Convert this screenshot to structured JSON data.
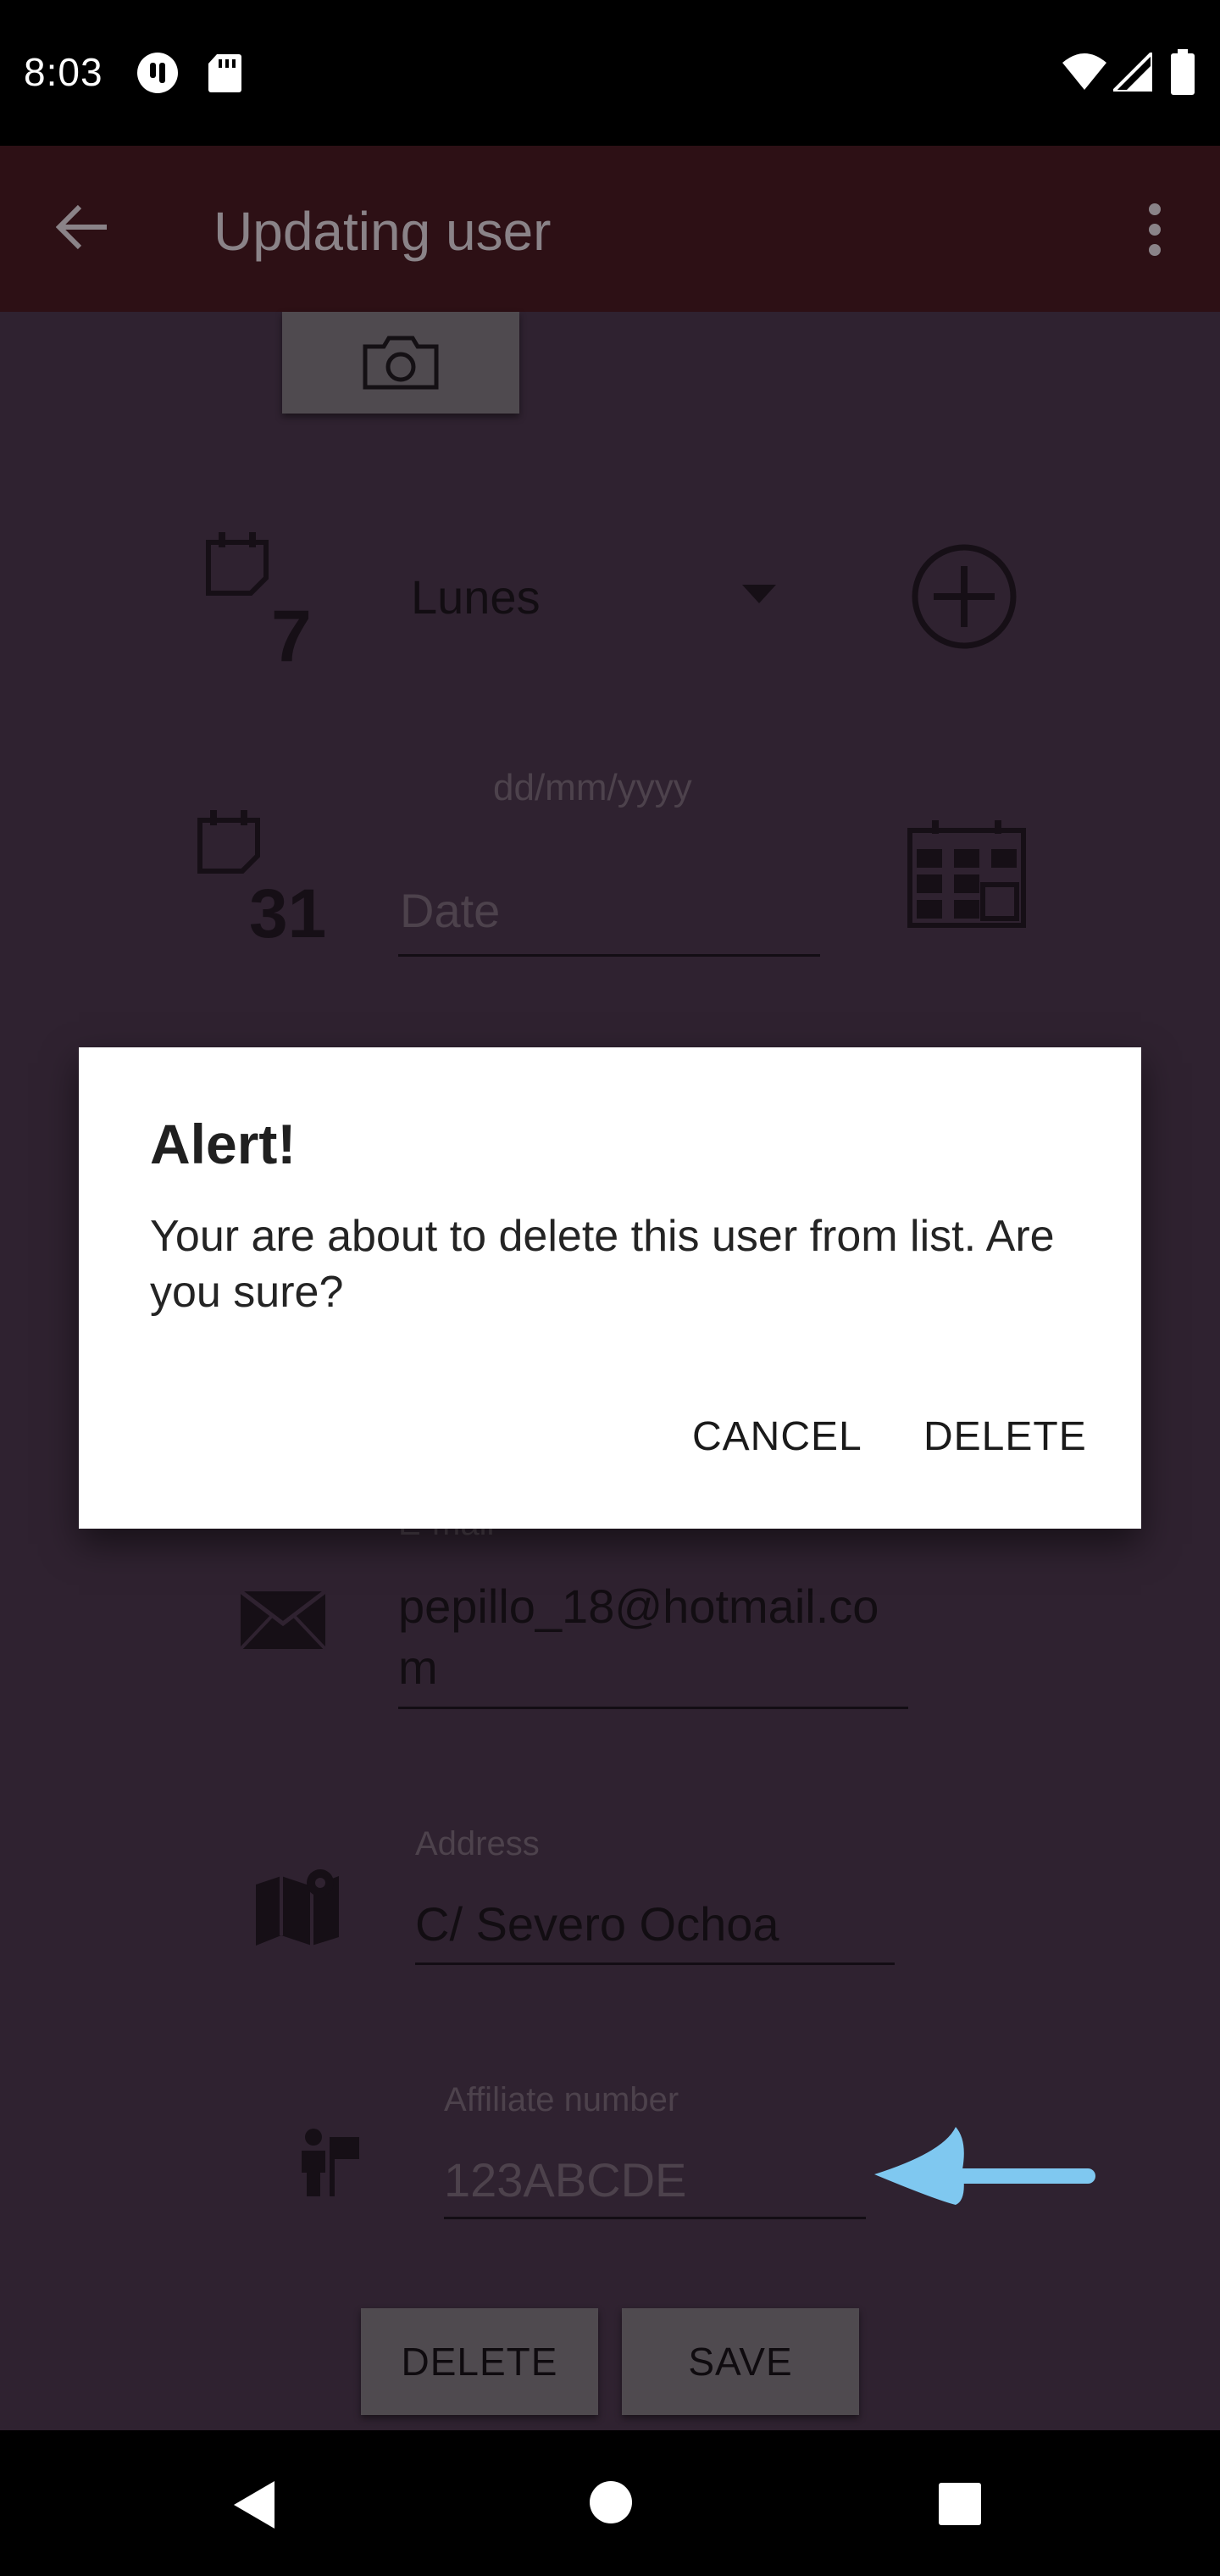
{
  "status_bar": {
    "time": "8:03",
    "icons": [
      "notification-icon",
      "sd-card-icon",
      "wifi-icon",
      "signal-icon",
      "battery-icon"
    ]
  },
  "app_bar": {
    "title": "Updating user",
    "back_icon": "arrow-back-icon",
    "menu_icon": "more-vert-icon"
  },
  "form": {
    "weekday_spinner": {
      "value": "Lunes",
      "icon": "calendar-7-icon",
      "add_icon": "add-circle-icon"
    },
    "date": {
      "hint": "dd/mm/yyyy",
      "placeholder": "Date",
      "icon": "calendar-31-icon",
      "picker_icon": "calendar-grid-icon"
    },
    "email": {
      "label": "E-mail",
      "value": "pepillo_18@hotmail.com",
      "icon": "mail-icon"
    },
    "address": {
      "label": "Address",
      "value": "C/ Severo Ochoa",
      "icon": "map-icon"
    },
    "affiliate": {
      "label": "Affiliate number",
      "placeholder": "123ABCDE",
      "icon": "person-flag-icon"
    },
    "buttons": {
      "delete": "DELETE",
      "save": "SAVE"
    }
  },
  "annotation": {
    "arrow_color": "#7fc8f0"
  },
  "dialog": {
    "title": "Alert!",
    "message": "Your are about to delete this user from list. Are you sure?",
    "cancel": "CANCEL",
    "confirm": "DELETE"
  },
  "colors": {
    "app_bar": "#2d1015",
    "background": "#2f2230",
    "dialog": "#ffffff"
  }
}
